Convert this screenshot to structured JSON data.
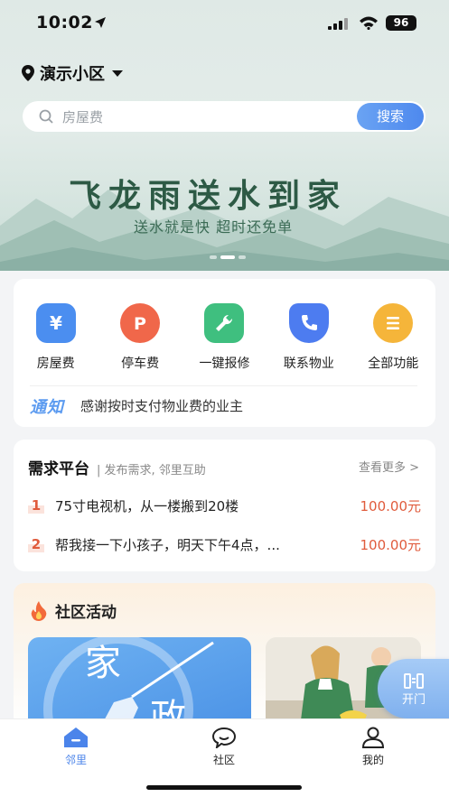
{
  "status": {
    "time": "10:02",
    "battery": "96"
  },
  "header": {
    "community": "演示小区"
  },
  "search": {
    "placeholder": "房屋费",
    "button": "搜索"
  },
  "banner": {
    "title": "飞龙雨送水到家",
    "subtitle": "送水就是快  超时还免单"
  },
  "functions": [
    {
      "label": "房屋费",
      "icon": "yen-wallet-icon",
      "color": "#4b8ef0"
    },
    {
      "label": "停车费",
      "icon": "parking-icon",
      "color": "#f0674a"
    },
    {
      "label": "一键报修",
      "icon": "wrench-icon",
      "color": "#3fbf7f"
    },
    {
      "label": "联系物业",
      "icon": "phone-shield-icon",
      "color": "#4d7cf0"
    },
    {
      "label": "全部功能",
      "icon": "menu-icon",
      "color": "#f5b53a"
    }
  ],
  "notice": {
    "tag": "通知",
    "text": "感谢按时支付物业费的业主"
  },
  "demand": {
    "title": "需求平台",
    "subtitle": "| 发布需求, 邻里互助",
    "more": "查看更多 >",
    "items": [
      {
        "no": "1",
        "text": "75寸电视机，从一楼搬到20楼",
        "price": "100.00元"
      },
      {
        "no": "2",
        "text": "帮我接一下小孩子，明天下午4点，...",
        "price": "100.00元"
      }
    ]
  },
  "activity": {
    "title": "社区活动",
    "image_text": "家 政"
  },
  "open_door": "开门",
  "tabs": [
    {
      "label": "邻里",
      "icon": "home-icon",
      "active": true
    },
    {
      "label": "社区",
      "icon": "chat-icon",
      "active": false
    },
    {
      "label": "我的",
      "icon": "user-icon",
      "active": false
    }
  ]
}
